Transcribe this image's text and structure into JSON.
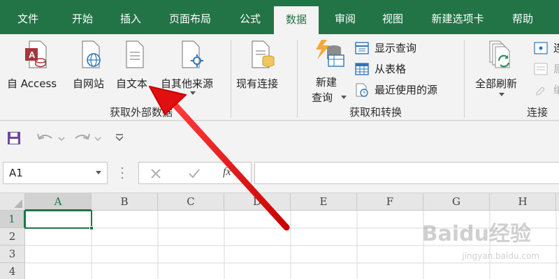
{
  "tabs": [
    "文件",
    "开始",
    "插入",
    "页面布局",
    "公式",
    "数据",
    "审阅",
    "视图",
    "新建选项卡",
    "帮助"
  ],
  "active_tab": "数据",
  "ribbon": {
    "get_external": {
      "buttons": [
        "自 Access",
        "自网站",
        "自文本",
        "自其他来源"
      ],
      "label": "获取外部数据"
    },
    "existing_connections": "现有连接",
    "get_transform": {
      "new_query": [
        "新建",
        "查询"
      ],
      "small_buttons": [
        "显示查询",
        "从表格",
        "最近使用的源"
      ],
      "label": "获取和转换"
    },
    "connections": {
      "refresh_all": "全部刷新",
      "partial": [
        "连",
        "属",
        "编"
      ],
      "label": "连接"
    }
  },
  "formula_bar": {
    "name_box": "A1",
    "fx": "fx",
    "formula": ""
  },
  "columns": [
    "A",
    "B",
    "C",
    "D",
    "E",
    "F",
    "G",
    "H"
  ],
  "rows": [
    "1",
    "2",
    "3",
    "4"
  ],
  "active_cell": "A1",
  "watermark": {
    "logo": "Baidu经验",
    "url": "jingyan.baidu.com"
  },
  "colors": {
    "brand": "#227447",
    "arrow": "#e01010"
  }
}
